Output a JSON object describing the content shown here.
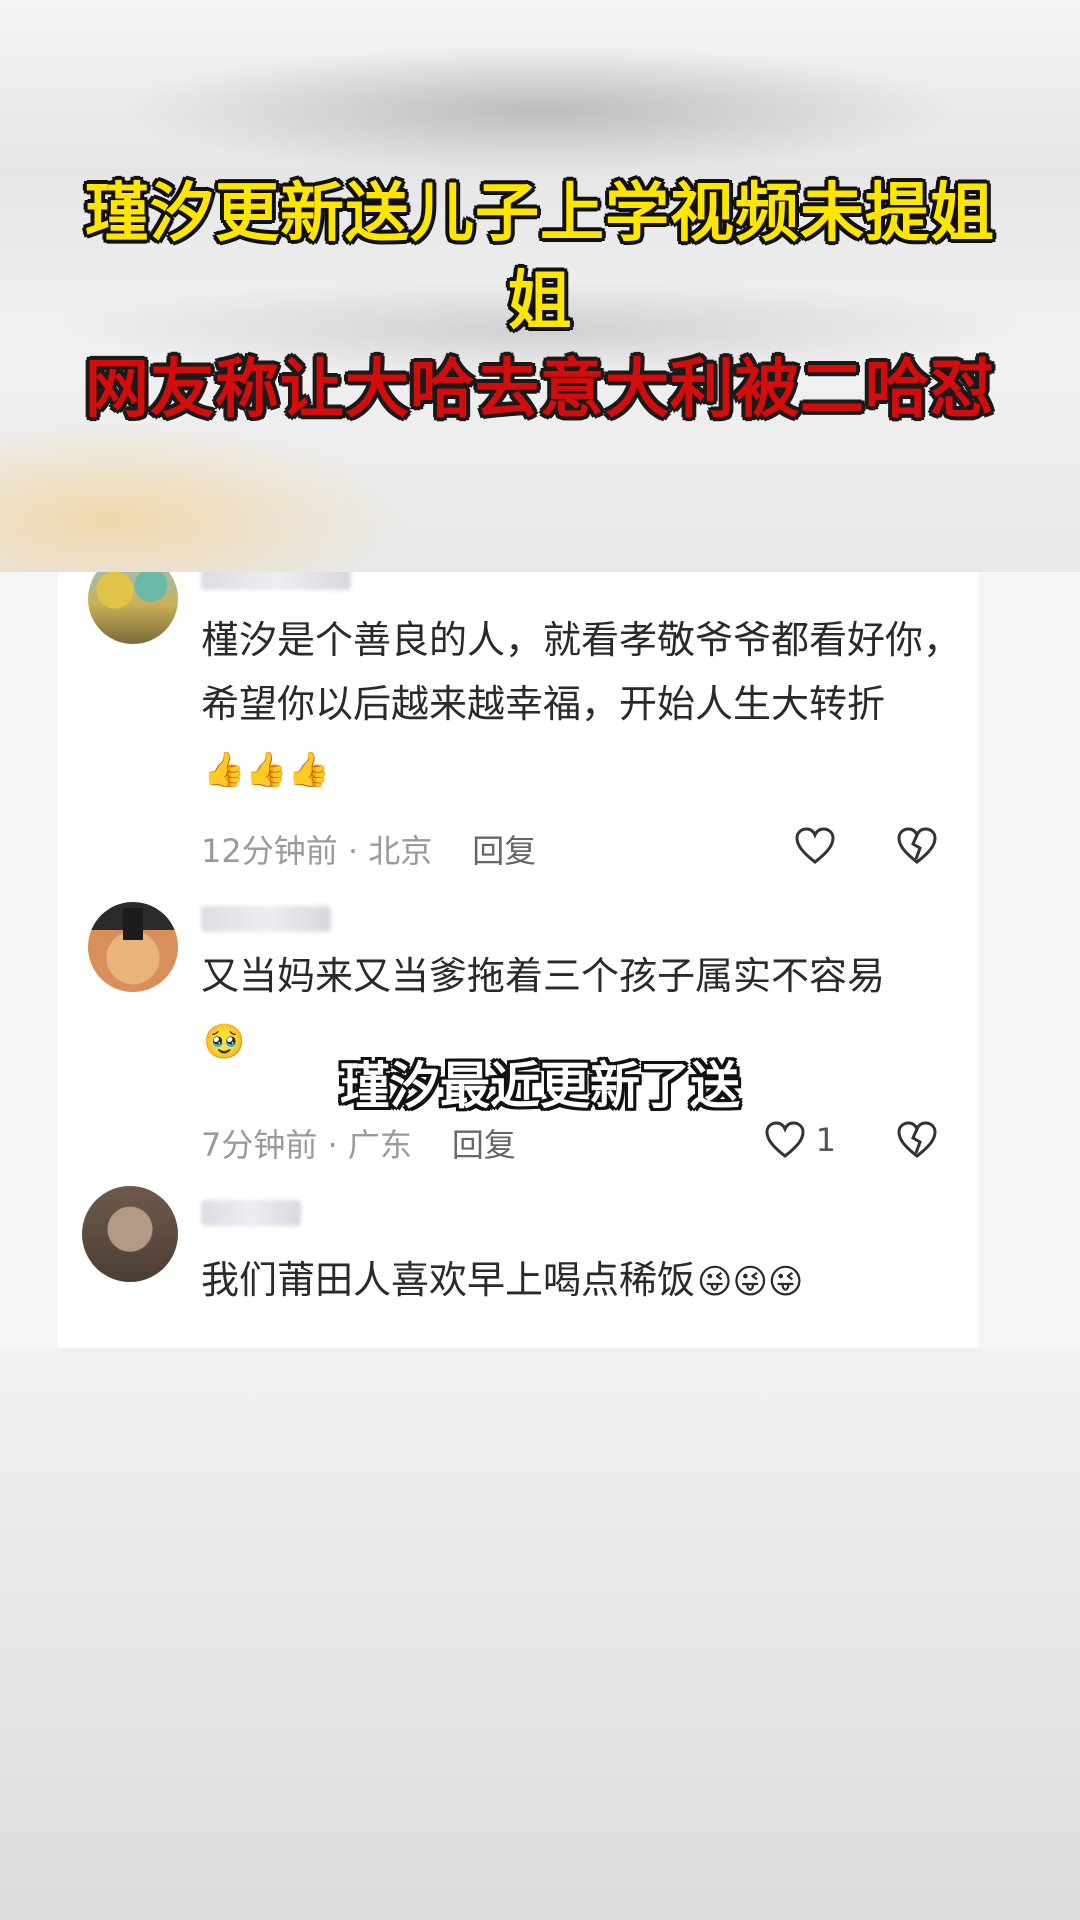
{
  "headline": {
    "line1": "瑾汐更新送儿子上学视频未提姐姐",
    "line2": "网友称让大哈去意大利被二哈怼"
  },
  "comments": [
    {
      "text": "槿汐是个善良的人，就看孝敬爷爷都看好你，希望你以后越来越幸福，开始人生大转折",
      "emoji": "👍👍👍",
      "time": "12分钟前",
      "location": "北京",
      "reply_label": "回复",
      "like_count": ""
    },
    {
      "text": "又当妈来又当爹拖着三个孩子属实不容易",
      "emoji": "🥹",
      "time": "7分钟前",
      "location": "广东",
      "reply_label": "回复",
      "like_count": "1"
    },
    {
      "text": "我们莆田人喜欢早上喝点稀饭",
      "emoji": "😜😜😜",
      "time": "",
      "location": "",
      "reply_label": "",
      "like_count": ""
    }
  ],
  "subtitle": "瑾汐最近更新了送",
  "icons": {
    "like": "heart-outline-icon",
    "dislike": "broken-heart-icon"
  },
  "colors": {
    "headline_yellow": "#ffe600",
    "headline_red": "#d30c0c",
    "meta_gray": "#9a9a9a"
  }
}
